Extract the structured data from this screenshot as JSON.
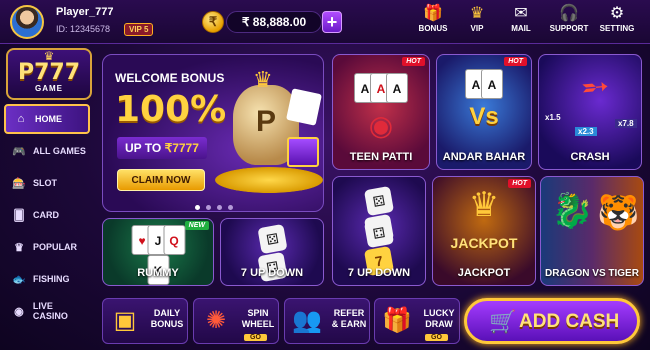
{
  "header": {
    "player_name": "Player_777",
    "player_id": "ID: 12345678",
    "vip_badge": "VIP 5",
    "balance": "₹ 88,888.00",
    "add_symbol": "+",
    "nav": [
      {
        "label": "BONUS",
        "icon": "gift-icon"
      },
      {
        "label": "VIP",
        "icon": "crown-icon"
      },
      {
        "label": "MAIL",
        "icon": "mail-icon"
      },
      {
        "label": "SUPPORT",
        "icon": "headset-icon"
      },
      {
        "label": "SETTING",
        "icon": "gear-icon"
      }
    ]
  },
  "logo": {
    "main": "P777",
    "sub": "GAME"
  },
  "sidebar": {
    "items": [
      {
        "label": "HOME",
        "icon": "home-icon",
        "active": true
      },
      {
        "label": "ALL GAMES",
        "icon": "gamepad-icon"
      },
      {
        "label": "SLOT",
        "icon": "slot-icon"
      },
      {
        "label": "CARD",
        "icon": "cards-icon"
      },
      {
        "label": "POPULAR",
        "icon": "crown-icon"
      },
      {
        "label": "FISHING",
        "icon": "fish-icon"
      },
      {
        "label": "LIVE CASINO",
        "icon": "casino-chip-icon"
      }
    ]
  },
  "banner": {
    "title": "WELCOME BONUS",
    "percent": "100%",
    "upto_label": "UP TO",
    "upto_amount": "₹7777",
    "cta": "CLAIM NOW",
    "bag_letter": "P"
  },
  "games": {
    "teen_patti": {
      "label": "TEEN PATTI",
      "badge": "HOT"
    },
    "andar_bahar": {
      "label": "ANDAR BAHAR",
      "badge": "HOT",
      "vs": "Vs"
    },
    "crash": {
      "label": "CRASH",
      "multipliers": [
        "x1.5",
        "x2.3",
        "x7.8"
      ]
    },
    "seven_up_big": {
      "label": "7 UP DOWN",
      "seven": "7"
    },
    "jackpot": {
      "label": "JACKPOT",
      "badge": "HOT",
      "art_text": "JACKPOT"
    },
    "dragon_tiger": {
      "label": "DRAGON VS TIGER"
    },
    "rummy": {
      "label": "RUMMY",
      "badge": "NEW"
    },
    "seven_up_small": {
      "label": "7 UP DOWN"
    }
  },
  "bottom": {
    "daily_bonus": {
      "line1": "DAILY",
      "line2": "BONUS"
    },
    "spin_wheel": {
      "line1": "SPIN",
      "line2": "WHEEL",
      "go": "GO"
    },
    "refer_earn": {
      "line1": "REFER",
      "line2": "& EARN"
    },
    "lucky_draw": {
      "line1": "LUCKY",
      "line2": "DRAW",
      "go": "GO"
    },
    "add_cash": "ADD CASH"
  },
  "colors": {
    "accent_gold": "#ffc83a",
    "purple": "#6b1ac8",
    "hot_red": "#e0102a",
    "new_green": "#20b040"
  }
}
